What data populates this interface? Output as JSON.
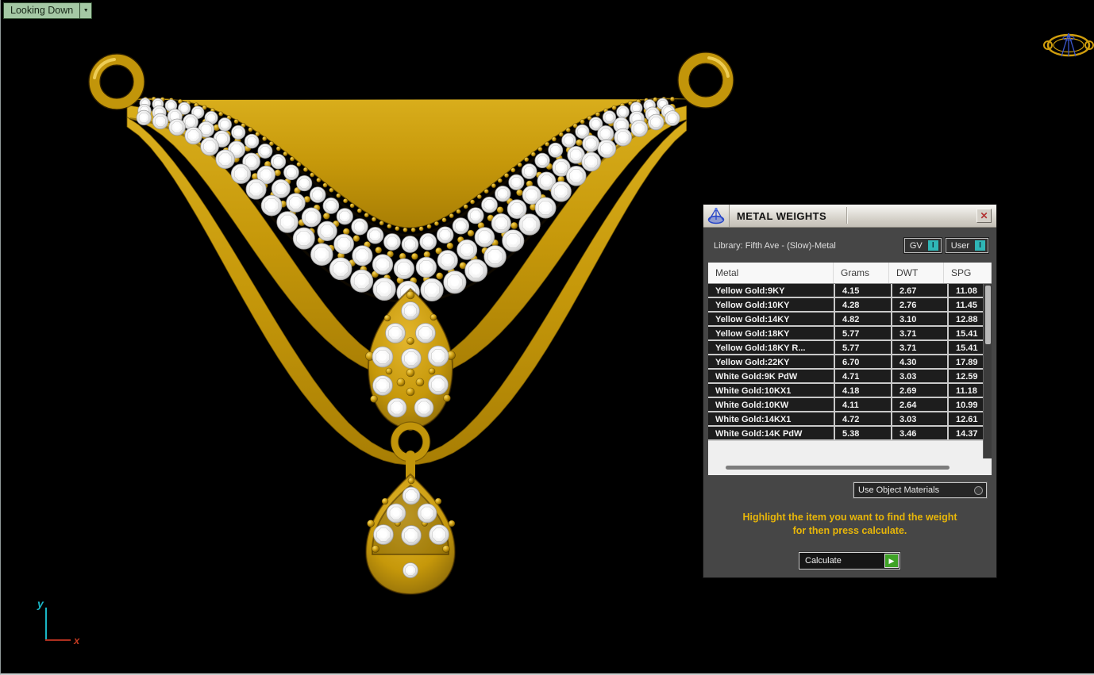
{
  "viewport": {
    "label": "Looking Down",
    "dropdown_glyph": "▼"
  },
  "axes": {
    "x": "x",
    "y": "y"
  },
  "dialog": {
    "title": "METAL WEIGHTS",
    "close_glyph": "✕",
    "library_label": "Library: Fifth Ave - (Slow)-Metal",
    "gv_label": "GV",
    "gv_toggle": "I",
    "user_label": "User",
    "user_toggle": "I",
    "table": {
      "columns": [
        "Metal",
        "Grams",
        "DWT",
        "SPG"
      ],
      "rows": [
        [
          "Yellow Gold:9KY",
          "4.15",
          "2.67",
          "11.08"
        ],
        [
          "Yellow Gold:10KY",
          "4.28",
          "2.76",
          "11.45"
        ],
        [
          "Yellow Gold:14KY",
          "4.82",
          "3.10",
          "12.88"
        ],
        [
          "Yellow Gold:18KY",
          "5.77",
          "3.71",
          "15.41"
        ],
        [
          "Yellow Gold:18KY R...",
          "5.77",
          "3.71",
          "15.41"
        ],
        [
          "Yellow Gold:22KY",
          "6.70",
          "4.30",
          "17.89"
        ],
        [
          "White Gold:9K PdW",
          "4.71",
          "3.03",
          "12.59"
        ],
        [
          "White Gold:10KX1",
          "4.18",
          "2.69",
          "11.18"
        ],
        [
          "White Gold:10KW",
          "4.11",
          "2.64",
          "10.99"
        ],
        [
          "White Gold:14KX1",
          "4.72",
          "3.03",
          "12.61"
        ],
        [
          "White Gold:14K PdW",
          "5.38",
          "3.46",
          "14.37"
        ]
      ]
    },
    "use_object_materials": "Use Object Materials",
    "instruction1": "Highlight the item you want to find the weight",
    "instruction2": "for then press calculate.",
    "calculate": "Calculate",
    "calculate_glyph": "▶"
  },
  "colors": {
    "gold": "#c6980a",
    "diamond": "#eeeeee",
    "accent_yellow": "#e8b609",
    "toggle_teal": "#2fb6b6",
    "calc_green": "#3fa327",
    "label_green": "#a4c8a4",
    "axis_x": "#c23b22",
    "axis_y": "#1ab5c4",
    "background": "#000000"
  }
}
